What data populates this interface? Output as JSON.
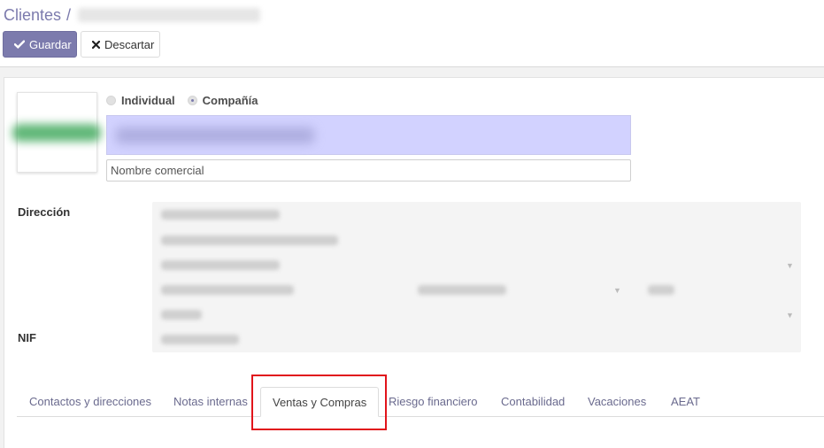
{
  "breadcrumb": {
    "parent": "Clientes",
    "separator": "/"
  },
  "toolbar": {
    "save_label": "Guardar",
    "discard_label": "Descartar"
  },
  "partner_type": {
    "options": [
      {
        "label": "Individual",
        "checked": false
      },
      {
        "label": "Compañía",
        "checked": true
      }
    ]
  },
  "form": {
    "trade_name_placeholder": "Nombre comercial",
    "address_label": "Dirección",
    "nif_label": "NIF"
  },
  "tabs": [
    {
      "label": "Contactos y direcciones"
    },
    {
      "label": "Notas internas"
    },
    {
      "label": "Ventas y Compras",
      "active": true
    },
    {
      "label": "Riesgo financiero"
    },
    {
      "label": "Contabilidad"
    },
    {
      "label": "Vacaciones"
    },
    {
      "label": "AEAT"
    }
  ],
  "colors": {
    "brand": "#7c7bad",
    "name_field_bg": "#d2d2ff",
    "highlight": "#e1141b"
  }
}
